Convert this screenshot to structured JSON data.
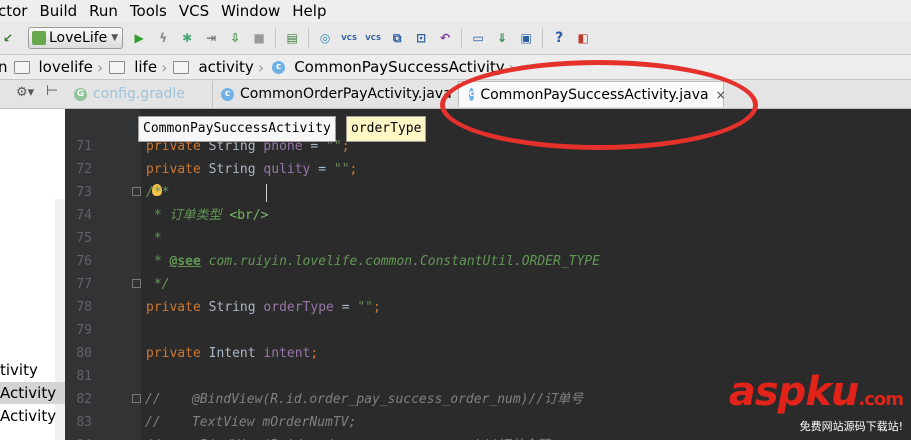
{
  "menu": {
    "items": [
      "ctor",
      "Build",
      "Run",
      "Tools",
      "VCS",
      "Window",
      "Help"
    ]
  },
  "toolbar": {
    "run_config": "LoveLife",
    "icons": [
      "run-icon",
      "lightning-icon",
      "debug-icon",
      "step-icon",
      "attach-icon",
      "stop-icon",
      "sdk-icon",
      "sync-icon",
      "vcs-update-icon",
      "vcs-commit-icon",
      "compare-icon",
      "history-icon",
      "revert-icon",
      "structure-icon",
      "download-icon",
      "terminal-icon",
      "help-icon",
      "plugin-icon"
    ],
    "vcs_label": "VCS"
  },
  "breadcrumb": {
    "items": [
      "n",
      "lovelife",
      "life",
      "activity",
      "CommonPaySuccessActivity"
    ]
  },
  "tabs": [
    {
      "label": "config.gradle",
      "closable": false
    },
    {
      "label": "CommonOrderPayActivity.java",
      "closable": true
    },
    {
      "label": "CommonPaySuccessActivity.java",
      "closable": true,
      "active": true
    }
  ],
  "tab_close_glyph": "×",
  "hints": {
    "class_name": "CommonPaySuccessActivity",
    "field_name": "orderType"
  },
  "project": {
    "items": [
      "tivity",
      "Activity",
      "Activity"
    ]
  },
  "editor": {
    "lines": [
      {
        "num": "71",
        "tokens": [
          [
            "kw",
            "private "
          ],
          [
            "plain",
            "String "
          ],
          [
            "fld",
            "phone"
          ],
          [
            "plain",
            " = "
          ],
          [
            "str",
            "\"\""
          ],
          [
            "kw",
            ";"
          ]
        ]
      },
      {
        "num": "72",
        "tokens": [
          [
            "kw",
            "private "
          ],
          [
            "plain",
            "String "
          ],
          [
            "fld",
            "qulity"
          ],
          [
            "plain",
            " = "
          ],
          [
            "str",
            "\"\""
          ],
          [
            "kw",
            ";"
          ]
        ]
      },
      {
        "num": "73",
        "tokens": [
          [
            "doc",
            "/**"
          ]
        ]
      },
      {
        "num": "74",
        "tokens": [
          [
            "doc",
            " * 订单类型 "
          ],
          [
            "tag",
            "<br/>"
          ]
        ]
      },
      {
        "num": "75",
        "tokens": [
          [
            "doc",
            " *"
          ]
        ]
      },
      {
        "num": "76",
        "tokens": [
          [
            "doc",
            " * "
          ],
          [
            "see",
            "@see"
          ],
          [
            "doc",
            " com.ruiyin.lovelife.common.ConstantUtil.ORDER_TYPE"
          ]
        ]
      },
      {
        "num": "77",
        "tokens": [
          [
            "doc",
            " */"
          ]
        ]
      },
      {
        "num": "78",
        "tokens": [
          [
            "kw",
            "private "
          ],
          [
            "plain",
            "String "
          ],
          [
            "fld",
            "orderType"
          ],
          [
            "plain",
            " = "
          ],
          [
            "str",
            "\"\""
          ],
          [
            "kw",
            ";"
          ]
        ]
      },
      {
        "num": "79",
        "tokens": []
      },
      {
        "num": "80",
        "tokens": [
          [
            "kw",
            "private "
          ],
          [
            "plain",
            "Intent "
          ],
          [
            "fld",
            "intent"
          ],
          [
            "kw",
            ";"
          ]
        ]
      },
      {
        "num": "81",
        "tokens": []
      },
      {
        "num": "82",
        "tokens": [
          [
            "cm",
            "//    @BindView(R.id.order_pay_success_order_num)//订单号"
          ]
        ]
      },
      {
        "num": "83",
        "tokens": [
          [
            "cm",
            "//    TextView mOrderNumTV;"
          ]
        ]
      },
      {
        "num": "84",
        "tokens": [
          [
            "cm",
            "//    @BindView(R.id.order_pay_success_xxx)//订单金额"
          ]
        ]
      }
    ]
  },
  "watermark": {
    "logo_main": "aspku",
    "logo_suffix": ".com",
    "subtitle": "免费网站源码下载站!"
  }
}
